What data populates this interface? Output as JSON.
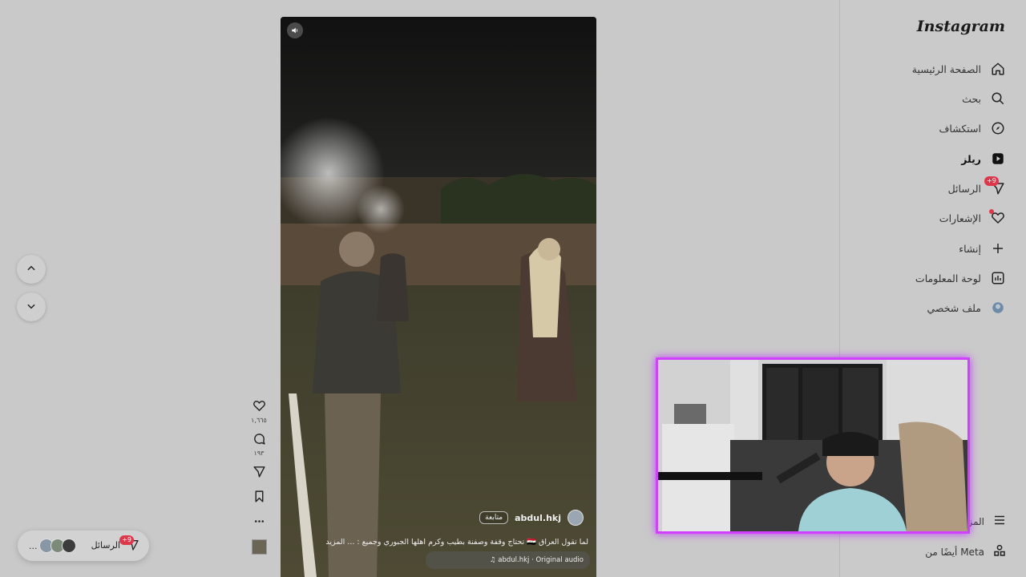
{
  "sidebar": {
    "logo": "Instagram",
    "items": [
      {
        "label": "الصفحة الرئيسية",
        "icon": "home-icon"
      },
      {
        "label": "بحث",
        "icon": "search-icon"
      },
      {
        "label": "استكشاف",
        "icon": "compass-icon"
      },
      {
        "label": "ريلز",
        "icon": "reels-icon"
      },
      {
        "label": "الرسائل",
        "icon": "send-icon",
        "badge": "+9"
      },
      {
        "label": "الإشعارات",
        "icon": "heart-icon"
      },
      {
        "label": "إنشاء",
        "icon": "plus-icon"
      },
      {
        "label": "لوحة المعلومات",
        "icon": "dashboard-icon"
      },
      {
        "label": "ملف شخصي",
        "icon": "avatar-icon"
      }
    ],
    "more_label": "المزيد",
    "meta_label": "أيضًا من Meta"
  },
  "reel": {
    "author": "abdul.hkj",
    "follow_label": "متابعة",
    "caption": "لما تقول العراق 🇮🇶 تحتاج وقفة وصفنة بطيب وكرم اهلها الجبوري وجميع : ... المزيد",
    "audio": "abdul.hkj · Original audio",
    "likes": "١,٦٦٥",
    "comments": "١٩٣"
  },
  "messages_pill": {
    "label": "الرسائل",
    "badge": "+9",
    "more": "..."
  },
  "colors": {
    "accent_badge": "#e0364a",
    "webcam_border": "#d040ff"
  }
}
